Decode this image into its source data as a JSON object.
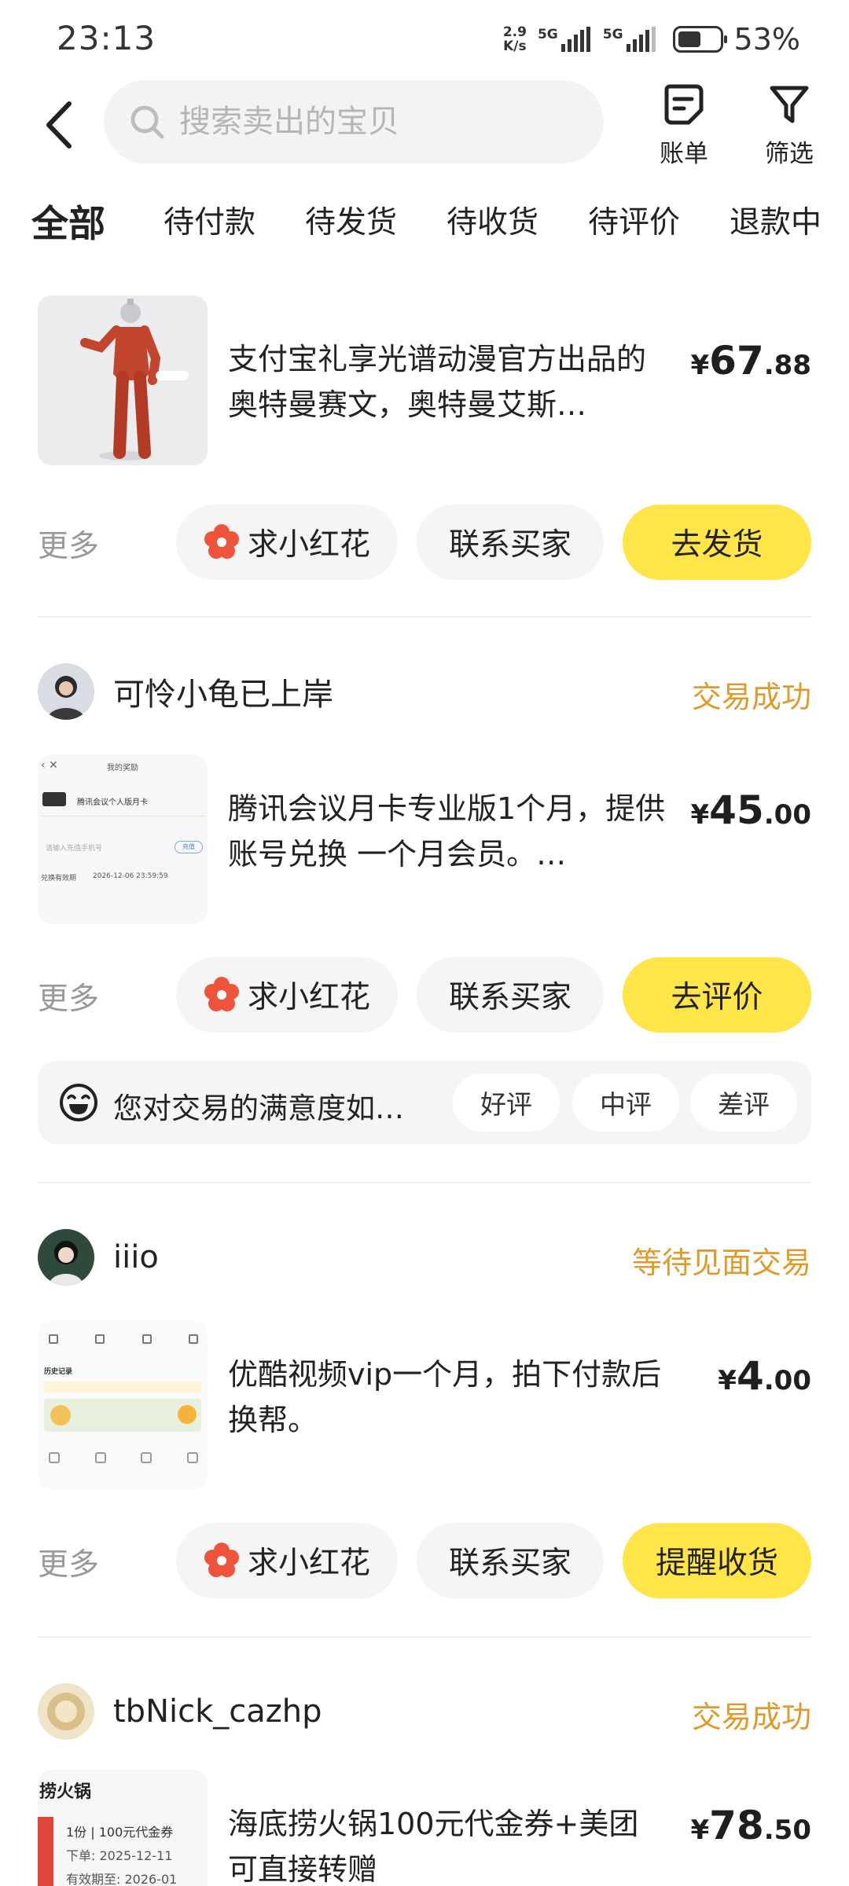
{
  "status_bar": {
    "time": "23:13",
    "speed_value": "2.9",
    "speed_unit": "K/s",
    "net1": "5G",
    "net2": "5G",
    "battery": "53%"
  },
  "header": {
    "search_placeholder": "搜索卖出的宝贝",
    "bill_label": "账单",
    "filter_label": "筛选"
  },
  "tabs": [
    "全部",
    "待付款",
    "待发货",
    "待收货",
    "待评价",
    "退款中"
  ],
  "common": {
    "more": "更多",
    "flower": "求小红花",
    "contact": "联系买家"
  },
  "orders": [
    {
      "title": "支付宝礼享光谱动漫官方出品的奥特曼赛文，奥特曼艾斯…",
      "price_currency": "¥",
      "price_int": "67",
      "price_dec": ".88",
      "primary_action": "去发货"
    },
    {
      "buyer": "可怜小龟已上岸",
      "status": "交易成功",
      "title": "腾讯会议月卡专业版1个月，提供账号兑换 一个月会员。…",
      "price_currency": "¥",
      "price_int": "45",
      "price_dec": ".00",
      "primary_action": "去评价",
      "thumb_text": {
        "header": "我的奖励",
        "item": "腾讯会议个人版月卡",
        "input": "请输入充值手机号",
        "badge": "充值",
        "expiry_label": "兑换有效期",
        "expiry": "2026-12-06 23:59:59"
      },
      "rating": {
        "prompt": "您对交易的满意度如…",
        "good": "好评",
        "neutral": "中评",
        "bad": "差评"
      }
    },
    {
      "buyer": "iiio",
      "status": "等待见面交易",
      "title": "优酷视频vip一个月，拍下付款后换帮。",
      "price_currency": "¥",
      "price_int": "4",
      "price_dec": ".00",
      "primary_action": "提醒收货",
      "thumb_text": {
        "section": "历史记录"
      }
    },
    {
      "buyer": "tbNick_cazhp",
      "status": "交易成功",
      "title": "海底捞火锅100元代金券+美团可直接转赠",
      "price_currency": "¥",
      "price_int": "78",
      "price_dec": ".50",
      "thumb_text": {
        "brand": "捞火锅",
        "line1": "1份 | 100元代金券",
        "line2": "下单: 2025-12-11",
        "line3": "有效期至: 2026-01"
      }
    }
  ],
  "colors": {
    "accent_yellow": "#ffe547",
    "status_orange": "#e09a2b",
    "flower_red": "#f0533b"
  }
}
